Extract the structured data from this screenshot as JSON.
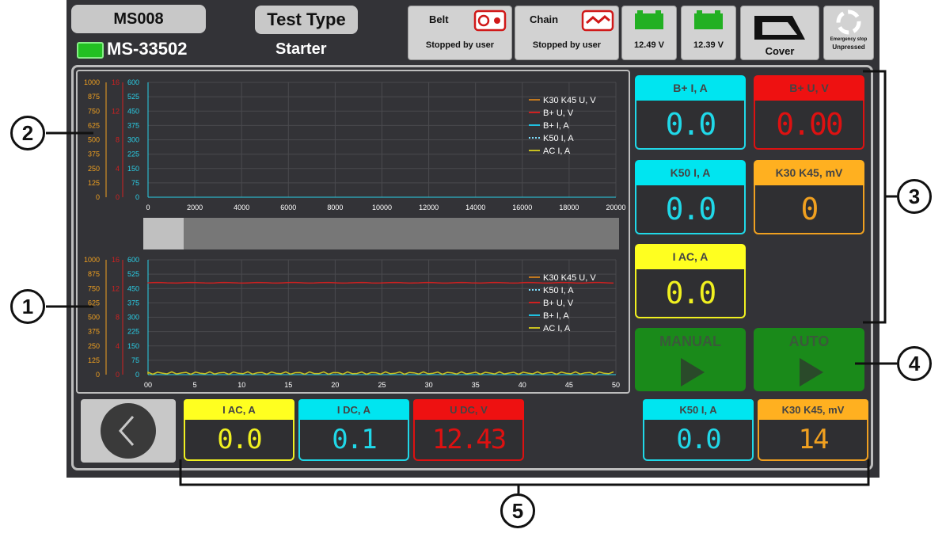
{
  "header": {
    "device_id": "MS008",
    "serial": "MS-33502",
    "test_type_label": "Test Type",
    "test_type_value": "Starter",
    "belt": {
      "label": "Belt",
      "status": "Stopped by user"
    },
    "chain": {
      "label": "Chain",
      "status": "Stopped by user"
    },
    "battery1": "12.49 V",
    "battery2": "12.39 V",
    "cover": "Cover",
    "estop": {
      "label": "Emergency stop",
      "status": "Unpressed"
    }
  },
  "charts": {
    "top": {
      "axis1_ticks": [
        "1000",
        "875",
        "750",
        "625",
        "500",
        "375",
        "250",
        "125",
        "0"
      ],
      "axis2_ticks": [
        "16",
        "12",
        "8",
        "4",
        "0"
      ],
      "axis3_ticks": [
        "600",
        "525",
        "450",
        "375",
        "300",
        "225",
        "150",
        "75",
        "0"
      ],
      "x_ticks": [
        "0",
        "2000",
        "4000",
        "6000",
        "8000",
        "10000",
        "12000",
        "14000",
        "16000",
        "18000",
        "20000"
      ],
      "legend": [
        "K30 K45 U, V",
        "B+ U, V",
        "B+ I, A",
        "K50 I, A",
        "AC I, A"
      ]
    },
    "bottom": {
      "axis1_ticks": [
        "1000",
        "875",
        "750",
        "625",
        "500",
        "375",
        "250",
        "125",
        "0"
      ],
      "axis2_ticks": [
        "16",
        "12",
        "8",
        "4",
        "0"
      ],
      "axis3_ticks": [
        "600",
        "525",
        "450",
        "375",
        "300",
        "225",
        "150",
        "75",
        "0"
      ],
      "x_ticks": [
        "00",
        "5",
        "10",
        "15",
        "20",
        "25",
        "30",
        "35",
        "40",
        "45",
        "50"
      ],
      "legend": [
        "K30 K45 U, V",
        "K50 I, A",
        "B+ U, V",
        "B+ I, A",
        "AC I, A"
      ]
    }
  },
  "chart_data": [
    {
      "type": "line",
      "series": [],
      "xlim": [
        0,
        20000
      ],
      "ylim": [
        0,
        600
      ]
    },
    {
      "type": "line",
      "xlim": [
        0,
        50
      ],
      "ylim": [
        0,
        600
      ],
      "series": [
        {
          "name": "B+ U, V",
          "color": "#d02020",
          "values_level": 0.8
        },
        {
          "name": "AC I, A",
          "color": "#c8c020",
          "values_level": 0.0
        }
      ]
    }
  ],
  "meters": [
    {
      "label": "B+ I, A",
      "value": "0.0",
      "head": "#00e5f0",
      "color": "#20d8e8"
    },
    {
      "label": "B+ U, V",
      "value": "0.00",
      "head": "#ee1111",
      "color": "#dd1111"
    },
    {
      "label": "K50 I, A",
      "value": "0.0",
      "head": "#00e5f0",
      "color": "#20d8e8"
    },
    {
      "label": "K30 K45, mV",
      "value": "0",
      "head": "#ffb020",
      "color": "#f0a020"
    },
    {
      "label": "I AC, A",
      "value": "0.0",
      "head": "#ffff20",
      "color": "#f0f020"
    }
  ],
  "buttons": {
    "manual": "MANUAL",
    "auto": "AUTO"
  },
  "bottom_meters": [
    {
      "label": "I AC, A",
      "value": "0.0",
      "head": "#ffff20",
      "color": "#f0f020"
    },
    {
      "label": "I DC, A",
      "value": "0.1",
      "head": "#00e5f0",
      "color": "#20d8e8"
    },
    {
      "label": "U DC, V",
      "value": "12.43",
      "head": "#ee1111",
      "color": "#dd1111"
    },
    {
      "label": "K50 I, A",
      "value": "0.0",
      "head": "#00e5f0",
      "color": "#20d8e8"
    },
    {
      "label": "K30 K45, mV",
      "value": "14",
      "head": "#ffb020",
      "color": "#f0a020"
    }
  ],
  "callouts": [
    "1",
    "2",
    "3",
    "4",
    "5"
  ]
}
